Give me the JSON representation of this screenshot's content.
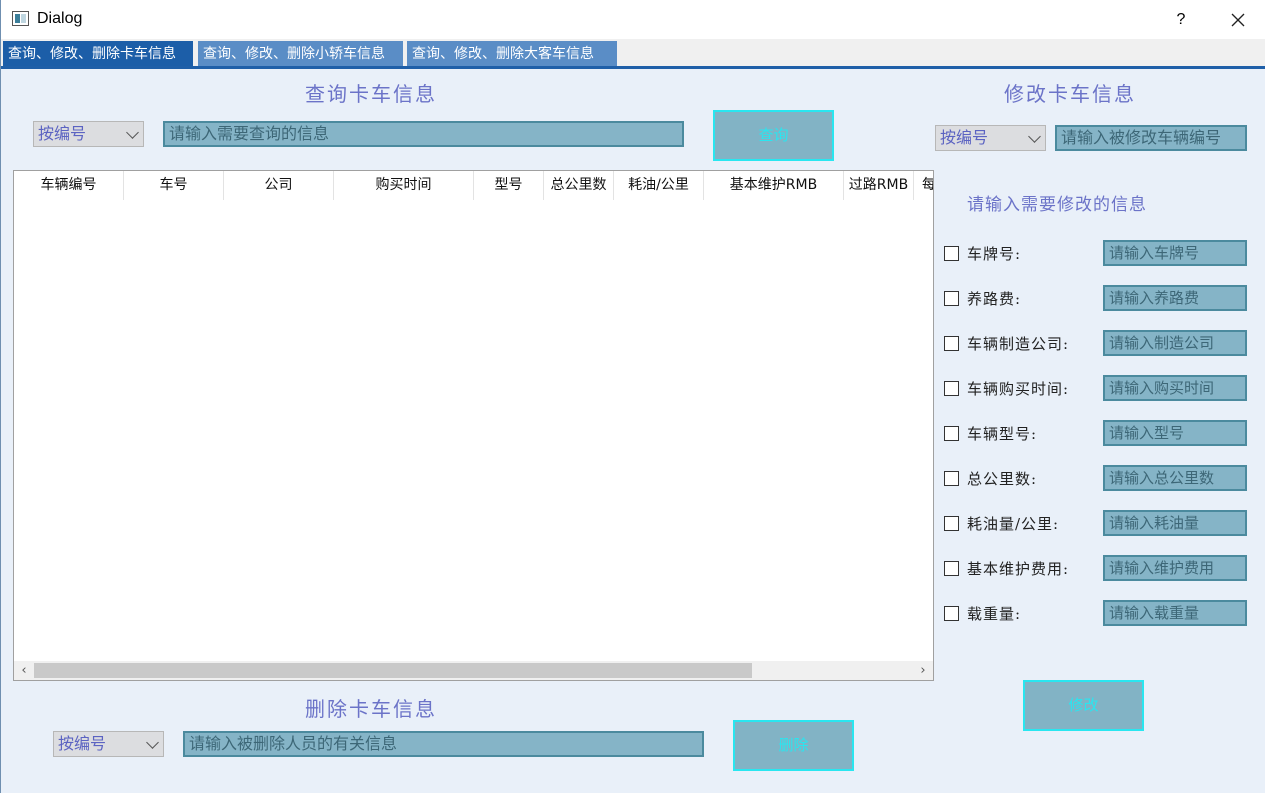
{
  "window": {
    "title": "Dialog",
    "help_label": "?"
  },
  "tabs": [
    {
      "label": "查询、修改、删除卡车信息"
    },
    {
      "label": "查询、修改、删除小轿车信息"
    },
    {
      "label": "查询、修改、删除大客车信息"
    }
  ],
  "query": {
    "title": "查询卡车信息",
    "filter_selected": "按编号",
    "input_placeholder": "请输入需要查询的信息",
    "button_label": "查询"
  },
  "table": {
    "columns": [
      "车辆编号",
      "车号",
      "公司",
      "购买时间",
      "型号",
      "总公里数",
      "耗油/公里",
      "基本维护RMB",
      "过路RMB",
      "每"
    ],
    "rows": [],
    "scroll_left_label": "‹",
    "scroll_right_label": "›"
  },
  "delete": {
    "title": "删除卡车信息",
    "filter_selected": "按编号",
    "input_placeholder": "请输入被删除人员的有关信息",
    "button_label": "删除"
  },
  "modify": {
    "title": "修改卡车信息",
    "filter_selected": "按编号",
    "input_placeholder": "请输入被修改车辆编号",
    "prompt": "请输入需要修改的信息",
    "button_label": "修改",
    "fields": [
      {
        "label": "车牌号:",
        "placeholder": "请输入车牌号",
        "checked": false
      },
      {
        "label": "养路费:",
        "placeholder": "请输入养路费",
        "checked": false
      },
      {
        "label": "车辆制造公司:",
        "placeholder": "请输入制造公司",
        "checked": false
      },
      {
        "label": "车辆购买时间:",
        "placeholder": "请输入购买时间",
        "checked": false
      },
      {
        "label": "车辆型号:",
        "placeholder": "请输入型号",
        "checked": false
      },
      {
        "label": "总公里数:",
        "placeholder": "请输入总公里数",
        "checked": false
      },
      {
        "label": "耗油量/公里:",
        "placeholder": "请输入耗油量",
        "checked": false
      },
      {
        "label": "基本维护费用:",
        "placeholder": "请输入维护费用",
        "checked": false
      },
      {
        "label": "载重量:",
        "placeholder": "请输入载重量",
        "checked": false
      }
    ]
  },
  "colors": {
    "accent_title": "#6b73c8",
    "input_bg": "#85b4c7",
    "button_text": "#29e6f0",
    "tab_active": "#1c5ea8"
  }
}
